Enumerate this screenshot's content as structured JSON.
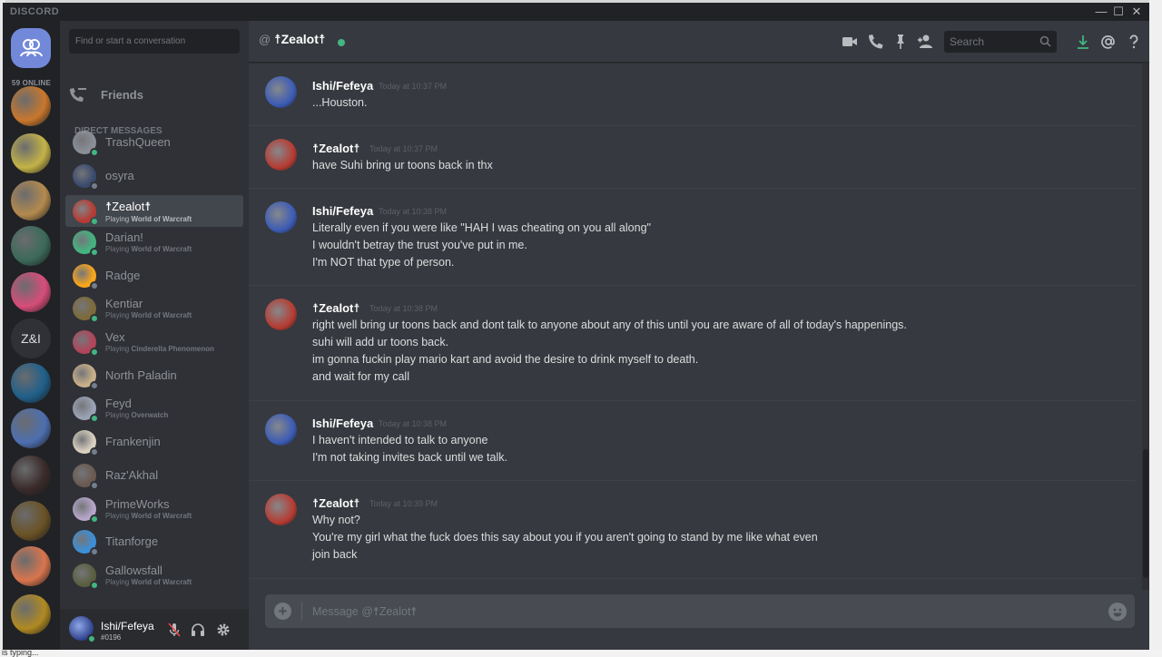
{
  "app": {
    "brand": "DISCORD"
  },
  "window_controls": {
    "minimize": "—",
    "maximize": "☐",
    "close": "✕"
  },
  "guilds": {
    "online_label": "59 ONLINE",
    "text_guild": "Z&I",
    "items": [
      {
        "name": "guild-1",
        "color": "#c9772c"
      },
      {
        "name": "guild-2",
        "color": "#c4b347"
      },
      {
        "name": "guild-3",
        "color": "#b48a4e"
      },
      {
        "name": "guild-4",
        "color": "#3b6a5a"
      },
      {
        "name": "guild-5",
        "color": "#d74d7a"
      },
      {
        "name": "guild-zi",
        "color": "#2f3136"
      },
      {
        "name": "guild-7",
        "color": "#1f5f8a"
      },
      {
        "name": "guild-8",
        "color": "#4d6fb0"
      },
      {
        "name": "guild-9",
        "color": "#3a2a2a"
      },
      {
        "name": "guild-10",
        "color": "#6a5225"
      },
      {
        "name": "guild-11",
        "color": "#d9754d"
      },
      {
        "name": "guild-12",
        "color": "#b08a22"
      }
    ]
  },
  "sidebar": {
    "search_placeholder": "Find or start a conversation",
    "friends_label": "Friends",
    "dm_header": "Direct Messages",
    "dms": [
      {
        "name": "TrashQueen",
        "activity": "",
        "game": "",
        "status": "#43b581",
        "avatar": "#8a8f98"
      },
      {
        "name": "osyra",
        "activity": "",
        "game": "",
        "status": "#747f8d",
        "avatar": "#3a4a6e"
      },
      {
        "name": "☨Zealot☨",
        "activity": "Playing ",
        "game": "World of Warcraft",
        "status": "#43b581",
        "avatar": "#b63b32"
      },
      {
        "name": "Darian!",
        "activity": "Playing ",
        "game": "World of Warcraft",
        "status": "#43b581",
        "avatar": "#43b581"
      },
      {
        "name": "Radge",
        "activity": "",
        "game": "",
        "status": "#747f8d",
        "avatar": "#faa61a"
      },
      {
        "name": "Kentiar",
        "activity": "Playing ",
        "game": "World of Warcraft",
        "status": "#43b581",
        "avatar": "#7c6a3a"
      },
      {
        "name": "Vex",
        "activity": "Playing ",
        "game": "Cinderella Phenomenon",
        "status": "#43b581",
        "avatar": "#b3445a"
      },
      {
        "name": "North Paladin",
        "activity": "",
        "game": "",
        "status": "#747f8d",
        "avatar": "#c9b089"
      },
      {
        "name": "Feyd",
        "activity": "Playing ",
        "game": "Overwatch",
        "status": "#43b581",
        "avatar": "#9aa3b5"
      },
      {
        "name": "Frankenjin",
        "activity": "",
        "game": "",
        "status": "#747f8d",
        "avatar": "#d9d0c0"
      },
      {
        "name": "Raz'Akhal",
        "activity": "",
        "game": "",
        "status": "#747f8d",
        "avatar": "#6a5a50"
      },
      {
        "name": "PrimeWorks",
        "activity": "Playing ",
        "game": "World of Warcraft",
        "status": "#43b581",
        "avatar": "#b6a6c9"
      },
      {
        "name": "Titanforge",
        "activity": "",
        "game": "",
        "status": "#747f8d",
        "avatar": "#3b8fd9"
      },
      {
        "name": "Gallowsfall",
        "activity": "Playing ",
        "game": "World of Warcraft",
        "status": "#43b581",
        "avatar": "#5a5f3f"
      }
    ]
  },
  "user": {
    "name": "Ishi/Fefeya",
    "tag": "#0196"
  },
  "chat": {
    "at_symbol": "@",
    "recipient": "☨Zealot☨",
    "search_placeholder": "Search",
    "composer_placeholder": "Message @☨Zealot☨",
    "composer_plus": "+",
    "groups": [
      {
        "author": "Ishi/Fefeya",
        "time": "Today at 10:37 PM",
        "avatar": "#3b5bb5",
        "lines": [
          "...Houston."
        ]
      },
      {
        "author": "☨Zealot☨",
        "time": "Today at 10:37 PM",
        "avatar": "#b63b32",
        "lines": [
          "have Suhi bring ur toons back in thx"
        ]
      },
      {
        "author": "Ishi/Fefeya",
        "time": "Today at 10:38 PM",
        "avatar": "#3b5bb5",
        "lines": [
          "Literally even if you were like \"HAH I was cheating on you all along\"",
          "I wouldn't betray the trust you've put in me.",
          "I'm NOT that type of person."
        ]
      },
      {
        "author": "☨Zealot☨",
        "time": "Today at 10:38 PM",
        "avatar": "#b63b32",
        "lines": [
          "right well bring ur toons back and dont talk to anyone about any of this until you are aware of all of today's happenings.",
          "suhi will add ur toons back.",
          "im gonna fuckin play mario kart and avoid the desire to drink myself to death.",
          "and wait for my call"
        ]
      },
      {
        "author": "Ishi/Fefeya",
        "time": "Today at 10:38 PM",
        "avatar": "#3b5bb5",
        "lines": [
          "I haven't intended to talk to anyone",
          "I'm not taking invites back until we talk."
        ]
      },
      {
        "author": "☨Zealot☨",
        "time": "Today at 10:39 PM",
        "avatar": "#b63b32",
        "lines": [
          "Why not?",
          "You're my girl what the fuck does this say about you if you aren't going to stand by me like what even",
          "join back"
        ]
      }
    ]
  },
  "taskbar_snippet": "is typing..."
}
